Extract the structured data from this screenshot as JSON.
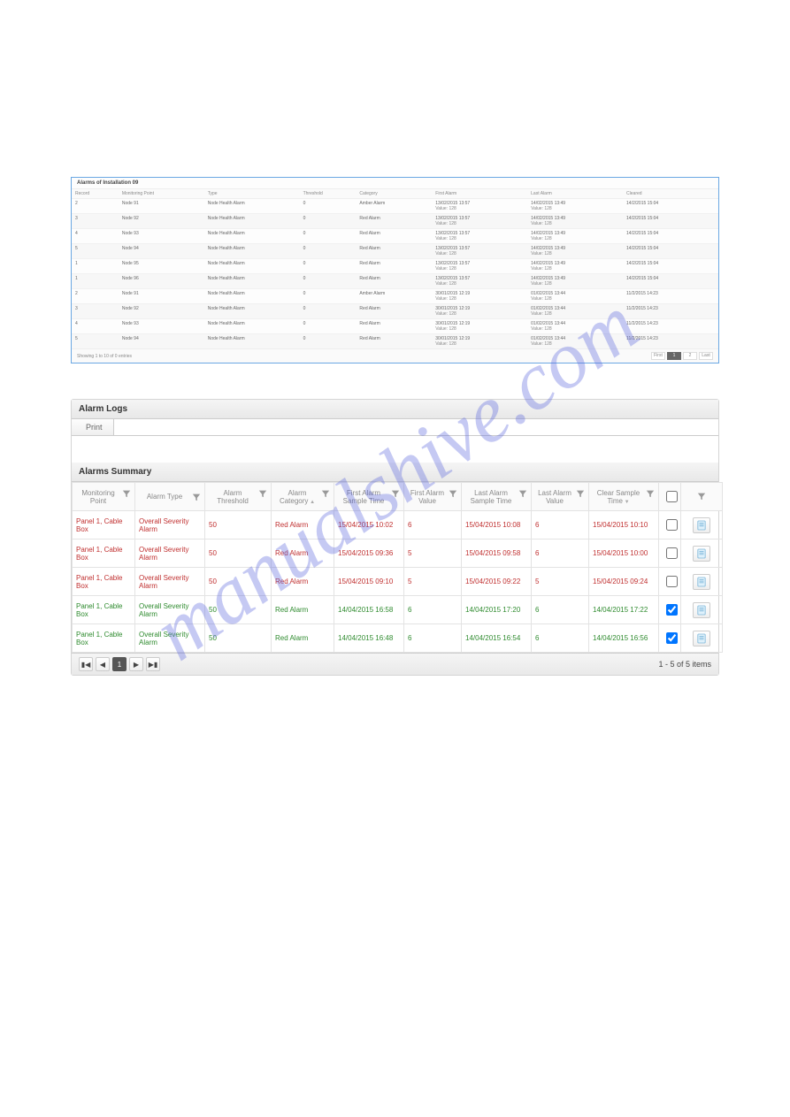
{
  "top": {
    "title": "Alarms of Installation 09",
    "columns": [
      "Record",
      "Monitoring Point",
      "Type",
      "Threshold",
      "Category",
      "First Alarm",
      "Last Alarm",
      "Cleared"
    ],
    "rows": [
      {
        "rec": "2",
        "mp": "Node 91",
        "type": "Node Health Alarm",
        "th": "0",
        "cat": "Amber Alarm",
        "f1": "13/02/2015 13:57",
        "f2": "Value: 128",
        "l1": "14/02/2015 13:49",
        "l2": "Value: 128",
        "clr": "14/2/2015 15:04"
      },
      {
        "rec": "3",
        "mp": "Node 92",
        "type": "Node Health Alarm",
        "th": "0",
        "cat": "Red Alarm",
        "f1": "13/02/2015 13:57",
        "f2": "Value: 128",
        "l1": "14/02/2015 13:49",
        "l2": "Value: 128",
        "clr": "14/2/2015 15:04"
      },
      {
        "rec": "4",
        "mp": "Node 93",
        "type": "Node Health Alarm",
        "th": "0",
        "cat": "Red Alarm",
        "f1": "13/02/2015 13:57",
        "f2": "Value: 128",
        "l1": "14/02/2015 13:49",
        "l2": "Value: 128",
        "clr": "14/2/2015 15:04"
      },
      {
        "rec": "5",
        "mp": "Node 94",
        "type": "Node Health Alarm",
        "th": "0",
        "cat": "Red Alarm",
        "f1": "13/02/2015 13:57",
        "f2": "Value: 128",
        "l1": "14/02/2015 13:49",
        "l2": "Value: 128",
        "clr": "14/2/2015 15:04"
      },
      {
        "rec": "1",
        "mp": "Node 95",
        "type": "Node Health Alarm",
        "th": "0",
        "cat": "Red Alarm",
        "f1": "13/02/2015 13:57",
        "f2": "Value: 128",
        "l1": "14/02/2015 13:49",
        "l2": "Value: 128",
        "clr": "14/2/2015 15:04"
      },
      {
        "rec": "1",
        "mp": "Node 96",
        "type": "Node Health Alarm",
        "th": "0",
        "cat": "Red Alarm",
        "f1": "13/02/2015 13:57",
        "f2": "Value: 128",
        "l1": "14/02/2015 13:49",
        "l2": "Value: 128",
        "clr": "14/2/2015 15:04"
      },
      {
        "rec": "2",
        "mp": "Node 91",
        "type": "Node Health Alarm",
        "th": "0",
        "cat": "Amber Alarm",
        "f1": "30/01/2015 12:19",
        "f2": "Value: 128",
        "l1": "01/02/2015 13:44",
        "l2": "Value: 128",
        "clr": "11/2/2015 14:23"
      },
      {
        "rec": "3",
        "mp": "Node 92",
        "type": "Node Health Alarm",
        "th": "0",
        "cat": "Red Alarm",
        "f1": "30/01/2015 12:19",
        "f2": "Value: 128",
        "l1": "01/02/2015 13:44",
        "l2": "Value: 128",
        "clr": "11/2/2015 14:23"
      },
      {
        "rec": "4",
        "mp": "Node 93",
        "type": "Node Health Alarm",
        "th": "0",
        "cat": "Red Alarm",
        "f1": "30/01/2015 12:19",
        "f2": "Value: 128",
        "l1": "01/02/2015 13:44",
        "l2": "Value: 128",
        "clr": "11/2/2015 14:23"
      },
      {
        "rec": "5",
        "mp": "Node 94",
        "type": "Node Health Alarm",
        "th": "0",
        "cat": "Red Alarm",
        "f1": "30/01/2015 12:19",
        "f2": "Value: 128",
        "l1": "01/02/2015 13:44",
        "l2": "Value: 128",
        "clr": "11/2/2015 14:23"
      }
    ],
    "footer_text": "Showing 1 to 10 of 0 entries",
    "pager": {
      "first": "First",
      "p1": "1",
      "p2": "2",
      "last": "Last"
    }
  },
  "logs": {
    "title": "Alarm Logs",
    "print": "Print",
    "summary_title": "Alarms Summary",
    "columns": {
      "mp": "Monitoring Point",
      "at": "Alarm Type",
      "th": "Alarm Threshold",
      "ac": "Alarm Category",
      "ft": "First Alarm Sample Time",
      "fv": "First Alarm Value",
      "lt": "Last Alarm Sample Time",
      "lv": "Last Alarm Value",
      "ct": "Clear Sample Time"
    },
    "rows": [
      {
        "cls": "red",
        "mp": "Panel 1, Cable Box",
        "at": "Overall Severity Alarm",
        "th": "50",
        "ac": "Red Alarm",
        "ft": "15/04/2015 10:02",
        "fv": "6",
        "lt": "15/04/2015 10:08",
        "lv": "6",
        "ct": "15/04/2015 10:10",
        "ck": false
      },
      {
        "cls": "red",
        "mp": "Panel 1, Cable Box",
        "at": "Overall Severity Alarm",
        "th": "50",
        "ac": "Red Alarm",
        "ft": "15/04/2015 09:36",
        "fv": "5",
        "lt": "15/04/2015 09:58",
        "lv": "6",
        "ct": "15/04/2015 10:00",
        "ck": false
      },
      {
        "cls": "red",
        "mp": "Panel 1, Cable Box",
        "at": "Overall Severity Alarm",
        "th": "50",
        "ac": "Red Alarm",
        "ft": "15/04/2015 09:10",
        "fv": "5",
        "lt": "15/04/2015 09:22",
        "lv": "5",
        "ct": "15/04/2015 09:24",
        "ck": false
      },
      {
        "cls": "green",
        "mp": "Panel 1, Cable Box",
        "at": "Overall Severity Alarm",
        "th": "50",
        "ac": "Red Alarm",
        "ft": "14/04/2015 16:58",
        "fv": "6",
        "lt": "14/04/2015 17:20",
        "lv": "6",
        "ct": "14/04/2015 17:22",
        "ck": true
      },
      {
        "cls": "green",
        "mp": "Panel 1, Cable Box",
        "at": "Overall Severity Alarm",
        "th": "50",
        "ac": "Red Alarm",
        "ft": "14/04/2015 16:48",
        "fv": "6",
        "lt": "14/04/2015 16:54",
        "lv": "6",
        "ct": "14/04/2015 16:56",
        "ck": true
      }
    ],
    "range": "1 - 5 of 5 items"
  },
  "watermark": "manualshive.com"
}
